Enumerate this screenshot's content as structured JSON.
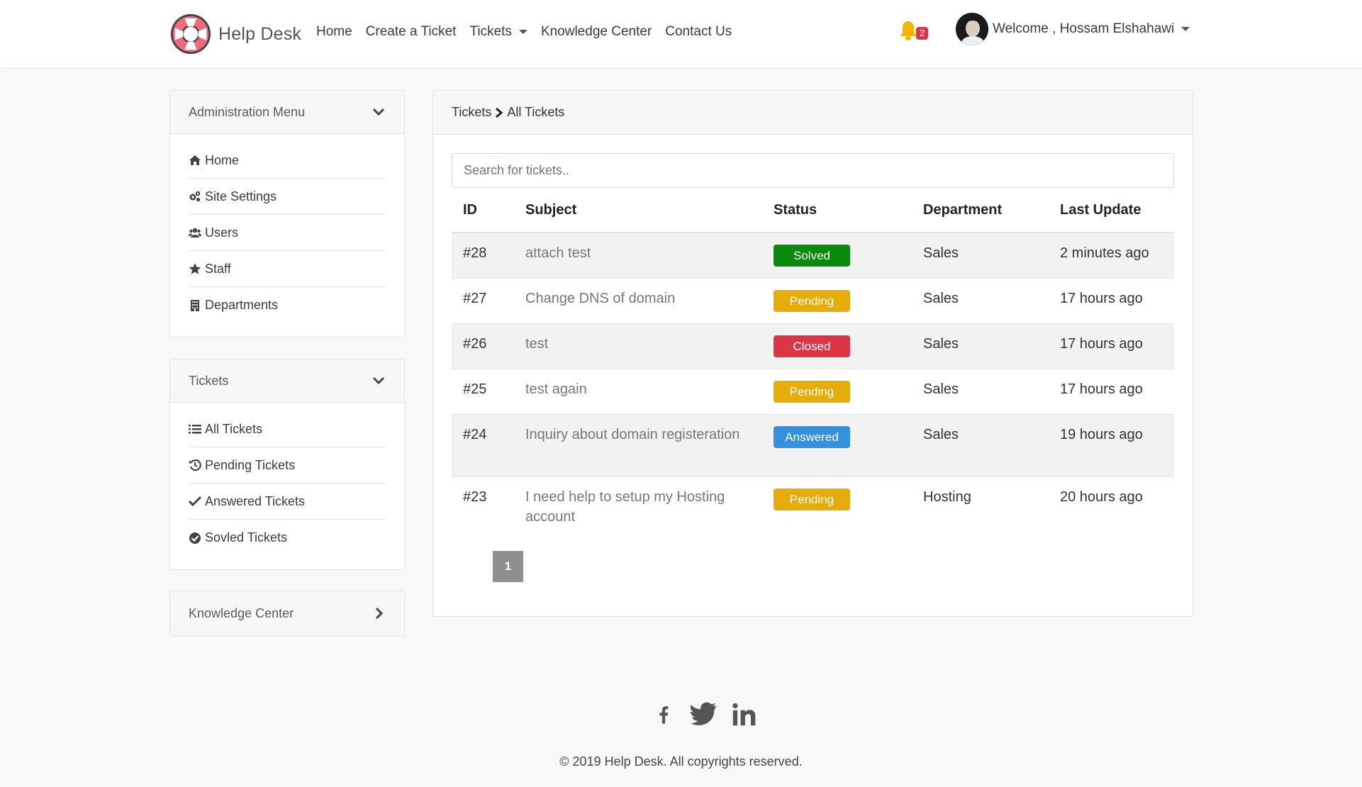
{
  "brand": {
    "name": "Help Desk"
  },
  "nav": {
    "links": [
      "Home",
      "Create a Ticket",
      "Tickets",
      "Knowledge Center",
      "Contact Us"
    ],
    "notification_count": "2",
    "user_greeting": "Welcome , Hossam Elshahawi"
  },
  "sidebar": {
    "admin": {
      "title": "Administration Menu",
      "items": [
        {
          "label": "Home",
          "icon": "home-icon"
        },
        {
          "label": "Site Settings",
          "icon": "gears-icon"
        },
        {
          "label": "Users",
          "icon": "users-icon"
        },
        {
          "label": "Staff",
          "icon": "star-icon"
        },
        {
          "label": "Departments",
          "icon": "building-icon"
        }
      ]
    },
    "tickets": {
      "title": "Tickets",
      "items": [
        {
          "label": "All Tickets",
          "icon": "list-icon"
        },
        {
          "label": "Pending Tickets",
          "icon": "history-icon"
        },
        {
          "label": "Answered Tickets",
          "icon": "check-icon"
        },
        {
          "label": "Sovled Tickets",
          "icon": "check-circle-icon"
        }
      ]
    },
    "knowledge": {
      "title": "Knowledge Center"
    }
  },
  "main": {
    "breadcrumb": {
      "parent": "Tickets",
      "current": "All Tickets"
    },
    "search_placeholder": "Search for tickets..",
    "columns": [
      "ID",
      "Subject",
      "Status",
      "Department",
      "Last Update"
    ],
    "rows": [
      {
        "id": "#28",
        "subject": "attach test",
        "status": "Solved",
        "department": "Sales",
        "updated": "2 minutes ago"
      },
      {
        "id": "#27",
        "subject": "Change DNS of domain",
        "status": "Pending",
        "department": "Sales",
        "updated": "17 hours ago"
      },
      {
        "id": "#26",
        "subject": "test",
        "status": "Closed",
        "department": "Sales",
        "updated": "17 hours ago"
      },
      {
        "id": "#25",
        "subject": "test again",
        "status": "Pending",
        "department": "Sales",
        "updated": "17 hours ago"
      },
      {
        "id": "#24",
        "subject": "Inquiry about domain registeration",
        "status": "Answered",
        "department": "Sales",
        "updated": "19 hours ago"
      },
      {
        "id": "#23",
        "subject": "I need help to setup my Hosting account",
        "status": "Pending",
        "department": "Hosting",
        "updated": "20 hours ago"
      }
    ],
    "page": "1"
  },
  "status_colors": {
    "Solved": "#0a8a0a",
    "Pending": "#e6ad0a",
    "Closed": "#dc3545",
    "Answered": "#3591dd"
  },
  "footer": {
    "social": [
      "facebook-icon",
      "twitter-icon",
      "linkedin-icon"
    ],
    "copyright": "© 2019 Help Desk. All copyrights reserved."
  }
}
